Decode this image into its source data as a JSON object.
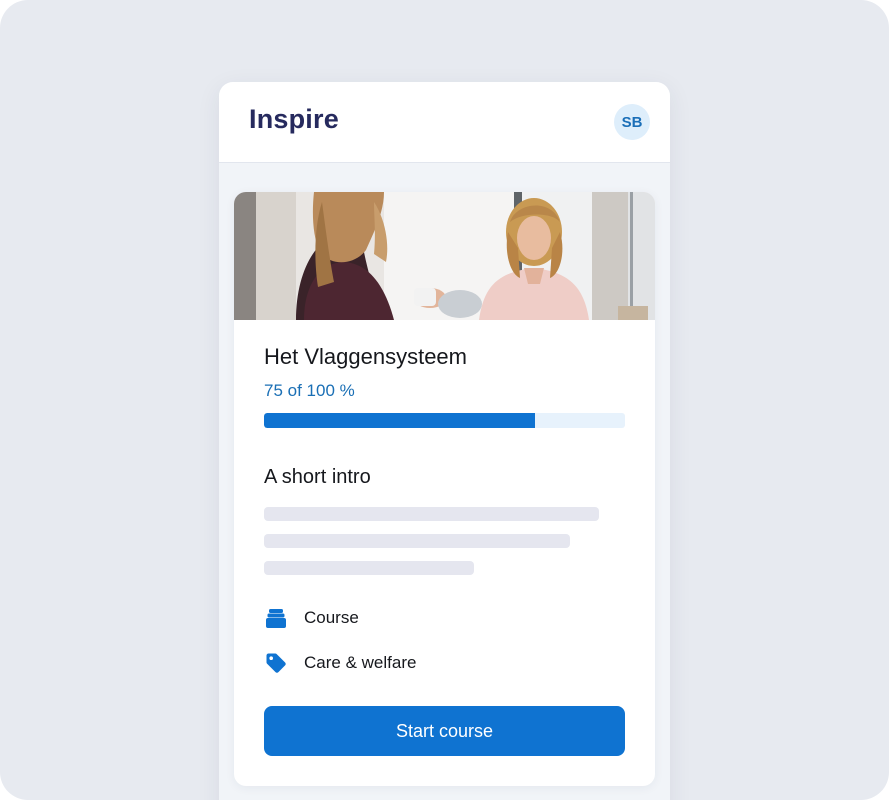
{
  "app": {
    "brand": "Inspire",
    "user_initials": "SB"
  },
  "course": {
    "title": "Het Vlaggensysteem",
    "progress_label": "75 of 100 %",
    "progress_value": 75,
    "progress_max": 100,
    "intro_heading": "A short intro",
    "meta": [
      {
        "icon": "stack-icon",
        "label": "Course"
      },
      {
        "icon": "tag-icon",
        "label": "Care & welfare"
      }
    ],
    "cta_label": "Start course"
  },
  "colors": {
    "brand_text": "#262a5e",
    "accent": "#0f73d1",
    "progress_track": "#e7f2fc",
    "background": "#e7eaf0"
  }
}
